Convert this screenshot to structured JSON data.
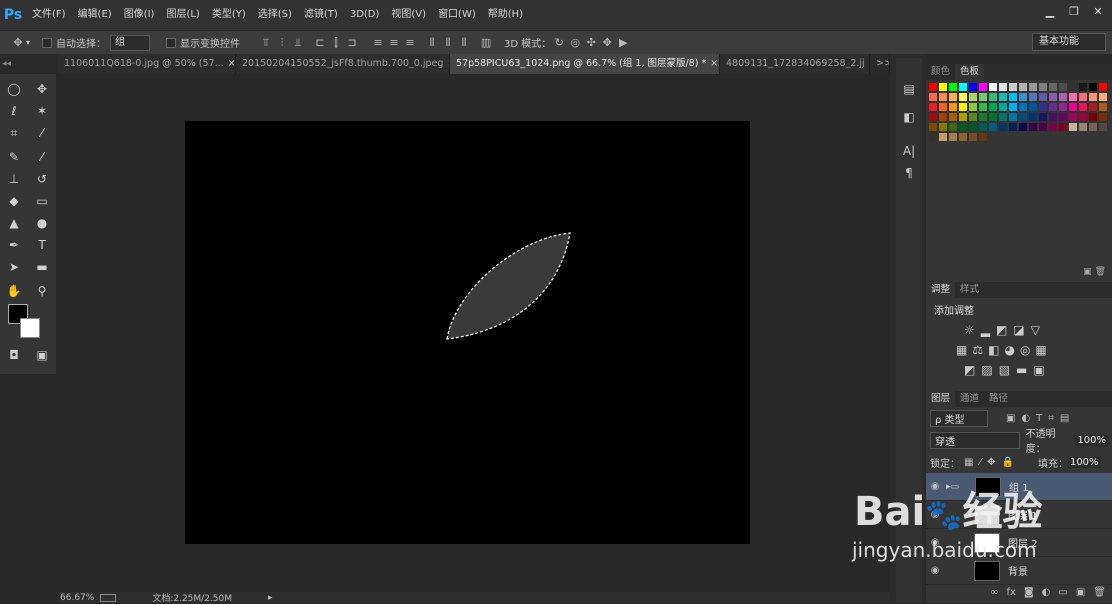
{
  "app": {
    "logo": "Ps"
  },
  "menu": [
    "文件(F)",
    "编辑(E)",
    "图像(I)",
    "图层(L)",
    "类型(Y)",
    "选择(S)",
    "滤镜(T)",
    "3D(D)",
    "视图(V)",
    "窗口(W)",
    "帮助(H)"
  ],
  "window_controls": [
    "▁",
    "❐",
    "✕"
  ],
  "options": {
    "auto_select_label": "自动选择：",
    "auto_select_value": "组",
    "show_transform_label": "显示变换控件",
    "mode3d_label": "3D 模式："
  },
  "workspace": "基本功能",
  "tabs": [
    {
      "label": "1106011Q618-0.jpg @ 50% (57...",
      "close": "×"
    },
    {
      "label": "20150204150552_jsFf8.thumb.700_0.jpeg",
      "close": "×"
    },
    {
      "label": "57p58PICU63_1024.png @ 66.7% (组 1, 图层蒙版/8) *",
      "close": "×"
    },
    {
      "label": "4809131_172834069258_2.jj",
      "close": ""
    }
  ],
  "tabs_overflow": ">>",
  "status": {
    "zoom": "66.67%",
    "doc": "文档:2.25M/2.50M"
  },
  "panels": {
    "color_tab": "颜色",
    "swatch_tab": "色板",
    "adjust_tab": "调整",
    "style_tab": "样式",
    "add_adjust": "添加调整",
    "layers_tab": "图层",
    "channels_tab": "通道",
    "paths_tab": "路径",
    "kind_filter": "ρ 类型",
    "blend_mode": "穿透",
    "opacity_label": "不透明度：",
    "opacity_value": "100%",
    "lock_label": "锁定：",
    "fill_label": "填充：",
    "fill_value": "100%"
  },
  "layers": [
    {
      "name": "组 1"
    },
    {
      "name": "图层 1"
    },
    {
      "name": "图层 2"
    },
    {
      "name": "背景"
    }
  ],
  "watermark": {
    "brand": "Bai",
    "brand2": "经验",
    "url": "jingyan.baidu.com"
  },
  "swatch_colors": [
    "#ff0000",
    "#ffff00",
    "#00ff00",
    "#00ffff",
    "#0000ff",
    "#ff00ff",
    "#ffffff",
    "#e6e6e6",
    "#cccccc",
    "#b3b3b3",
    "#999999",
    "#808080",
    "#666666",
    "#4d4d4d",
    "#333333",
    "#1a1a1a",
    "#000000",
    "#ff0000",
    "#f26c4f",
    "#f68e55",
    "#fbaf5c",
    "#fff467",
    "#acd372",
    "#7cc576",
    "#3bb878",
    "#1abbb4",
    "#00bff3",
    "#438ccb",
    "#5574b9",
    "#605ca8",
    "#855fa8",
    "#a763a9",
    "#f06ea9",
    "#f26d7d",
    "#f7977a",
    "#fbad82",
    "#ed1c24",
    "#f26522",
    "#f7941d",
    "#fff200",
    "#8dc63f",
    "#39b54a",
    "#00a651",
    "#00a99d",
    "#00aeef",
    "#0072bc",
    "#0054a6",
    "#2e3192",
    "#662d91",
    "#92278f",
    "#ec008c",
    "#ed145b",
    "#aa1d22",
    "#ab5d1f",
    "#9e0b0f",
    "#a0410d",
    "#a3620a",
    "#aba000",
    "#598527",
    "#1a7b30",
    "#007236",
    "#00746b",
    "#0076a3",
    "#004b80",
    "#003471",
    "#1b1464",
    "#440e62",
    "#630460",
    "#9e005d",
    "#9e0039",
    "#790000",
    "#7b2e00",
    "#7d4900",
    "#827b00",
    "#406618",
    "#005e20",
    "#005826",
    "#005952",
    "#005b7f",
    "#003663",
    "#002157",
    "#0d004c",
    "#32004b",
    "#4b0049",
    "#7b0046",
    "#7a0026",
    "#c7b299",
    "#998675",
    "#736357",
    "#534741",
    "#37302a",
    "#c69c6d",
    "#a67c52",
    "#8c6239",
    "#754c24",
    "#603913"
  ]
}
